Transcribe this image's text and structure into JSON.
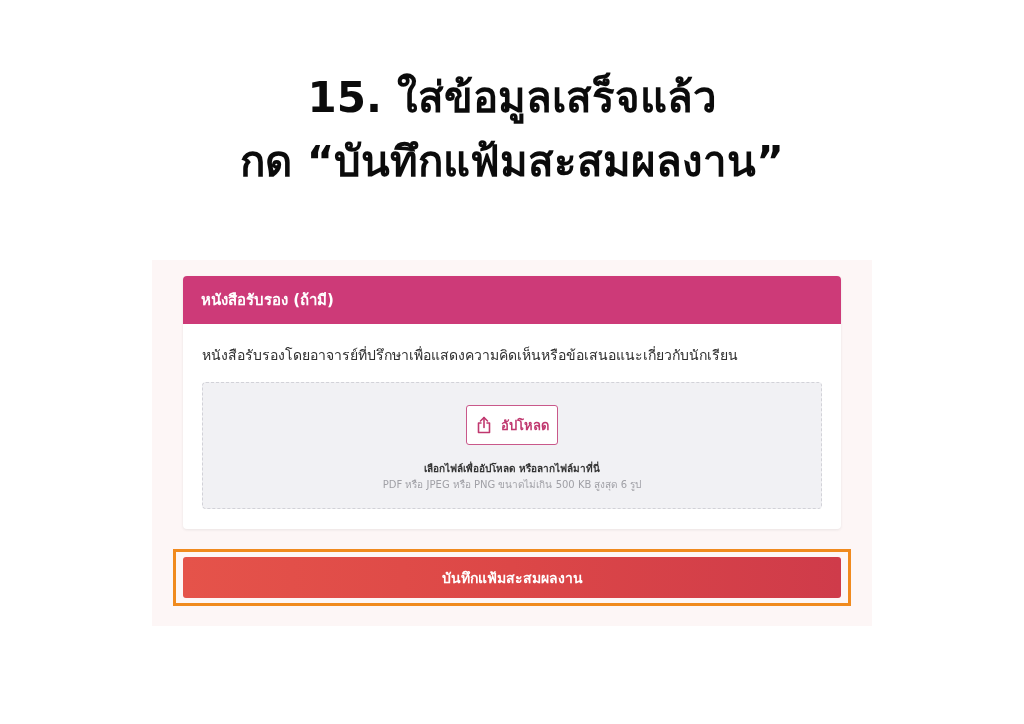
{
  "instruction": {
    "lines": [
      "15. ใส่ข้อมูลเสร็จแล้ว",
      "กด “บันทึกแฟ้มสะสมผลงาน”"
    ]
  },
  "card": {
    "title": "หนังสือรับรอง (ถ้ามี)",
    "description": "หนังสือรับรองโดยอาจารย์ที่ปรึกษาเพื่อแสดงความคิดเห็นหรือข้อเสนอแนะเกี่ยวกับนักเรียน",
    "dropzone": {
      "upload_button": "อัปโหลด",
      "prompt": "เลือกไฟล์เพื่ออัปโหลด หรือลากไฟล์มาที่นี่",
      "hint": "PDF หรือ JPEG หรือ PNG ขนาดไม่เกิน 500 KB สูงสุด 6 รูป"
    }
  },
  "save_button": {
    "label": "บันทึกแฟ้มสะสมผลงาน",
    "highlighted": true
  }
}
